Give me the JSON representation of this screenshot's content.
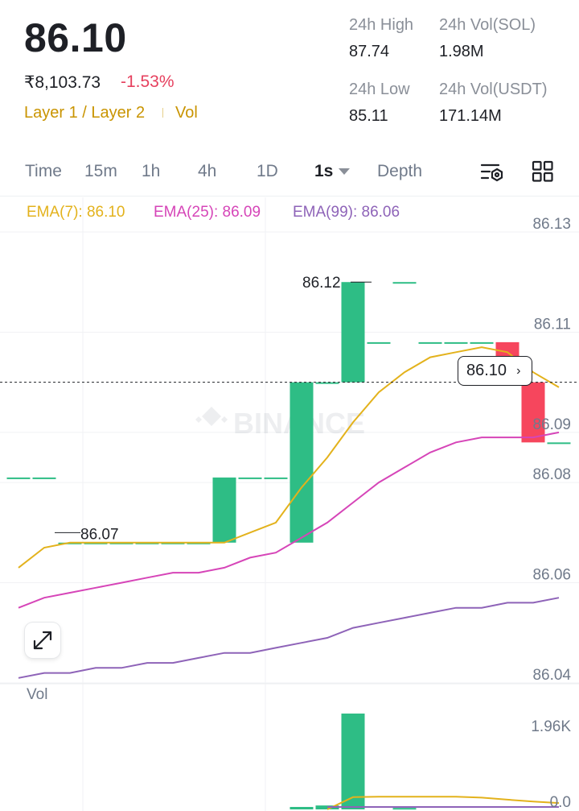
{
  "header": {
    "price": "86.10",
    "price_inr": "₹8,103.73",
    "change": "-1.53%",
    "category": "Layer 1 / Layer 2",
    "category_extra": "Vol",
    "stats": {
      "high_label": "24h High",
      "high_value": "87.74",
      "vol_sol_label": "24h Vol(SOL)",
      "vol_sol_value": "1.98M",
      "low_label": "24h Low",
      "low_value": "85.11",
      "vol_usdt_label": "24h Vol(USDT)",
      "vol_usdt_value": "171.14M"
    }
  },
  "tabs": [
    "Time",
    "15m",
    "1h",
    "4h",
    "1D",
    "1s",
    "Depth"
  ],
  "active_tab": "1s",
  "indicators": {
    "ema7": "EMA(7): 86.10",
    "ema25": "EMA(25): 86.09",
    "ema99": "EMA(99): 86.06"
  },
  "colors": {
    "up": "#2ebd85",
    "down": "#f6465d",
    "ema7": "#e3b21c",
    "ema25": "#d645b8",
    "ema99": "#8e63b8",
    "accent": "#c99400"
  },
  "chart_data": {
    "type": "candlestick",
    "price_ticks": [
      "86.13",
      "86.11",
      "86.09",
      "86.08",
      "86.06",
      "86.04"
    ],
    "current_price_label": "86.10",
    "high_marker": "86.12",
    "low_marker": "86.07",
    "watermark": "BINANCE",
    "candles": [
      {
        "o": 86.081,
        "h": 86.081,
        "l": 86.081,
        "c": 86.081,
        "d": "flat"
      },
      {
        "o": 86.081,
        "h": 86.081,
        "l": 86.081,
        "c": 86.081,
        "d": "flat"
      },
      {
        "o": 86.068,
        "h": 86.068,
        "l": 86.068,
        "c": 86.068,
        "d": "flat"
      },
      {
        "o": 86.068,
        "h": 86.068,
        "l": 86.068,
        "c": 86.068,
        "d": "flat"
      },
      {
        "o": 86.068,
        "h": 86.068,
        "l": 86.068,
        "c": 86.068,
        "d": "flat"
      },
      {
        "o": 86.068,
        "h": 86.068,
        "l": 86.068,
        "c": 86.068,
        "d": "flat"
      },
      {
        "o": 86.068,
        "h": 86.068,
        "l": 86.068,
        "c": 86.068,
        "d": "flat"
      },
      {
        "o": 86.068,
        "h": 86.068,
        "l": 86.068,
        "c": 86.068,
        "d": "flat"
      },
      {
        "o": 86.068,
        "h": 86.081,
        "l": 86.068,
        "c": 86.081,
        "d": "up"
      },
      {
        "o": 86.081,
        "h": 86.081,
        "l": 86.081,
        "c": 86.081,
        "d": "flat"
      },
      {
        "o": 86.081,
        "h": 86.081,
        "l": 86.081,
        "c": 86.081,
        "d": "flat"
      },
      {
        "o": 86.068,
        "h": 86.1,
        "l": 86.068,
        "c": 86.1,
        "d": "up"
      },
      {
        "o": 86.1,
        "h": 86.1,
        "l": 86.1,
        "c": 86.1,
        "d": "flat"
      },
      {
        "o": 86.1,
        "h": 86.12,
        "l": 86.1,
        "c": 86.12,
        "d": "up"
      },
      {
        "o": 86.108,
        "h": 86.108,
        "l": 86.108,
        "c": 86.108,
        "d": "flat"
      },
      {
        "o": 86.12,
        "h": 86.12,
        "l": 86.12,
        "c": 86.12,
        "d": "flat"
      },
      {
        "o": 86.108,
        "h": 86.108,
        "l": 86.108,
        "c": 86.108,
        "d": "flat"
      },
      {
        "o": 86.108,
        "h": 86.108,
        "l": 86.108,
        "c": 86.108,
        "d": "flat"
      },
      {
        "o": 86.108,
        "h": 86.108,
        "l": 86.108,
        "c": 86.108,
        "d": "flat"
      },
      {
        "o": 86.108,
        "h": 86.108,
        "l": 86.1,
        "c": 86.1,
        "d": "down"
      },
      {
        "o": 86.1,
        "h": 86.1,
        "l": 86.088,
        "c": 86.088,
        "d": "down"
      },
      {
        "o": 86.088,
        "h": 86.088,
        "l": 86.088,
        "c": 86.088,
        "d": "flat"
      }
    ],
    "ema7": [
      86.063,
      86.067,
      86.068,
      86.068,
      86.068,
      86.068,
      86.068,
      86.068,
      86.068,
      86.07,
      86.072,
      86.079,
      86.085,
      86.092,
      86.098,
      86.102,
      86.105,
      86.106,
      86.107,
      86.106,
      86.102,
      86.099
    ],
    "ema25": [
      86.055,
      86.057,
      86.058,
      86.059,
      86.06,
      86.061,
      86.062,
      86.062,
      86.063,
      86.065,
      86.066,
      86.069,
      86.072,
      86.076,
      86.08,
      86.083,
      86.086,
      86.088,
      86.089,
      86.089,
      86.089,
      86.09
    ],
    "ema99": [
      86.041,
      86.042,
      86.042,
      86.043,
      86.043,
      86.044,
      86.044,
      86.045,
      86.046,
      86.046,
      86.047,
      86.048,
      86.049,
      86.051,
      86.052,
      86.053,
      86.054,
      86.055,
      86.055,
      86.056,
      86.056,
      86.057
    ],
    "volume": {
      "label": "Vol",
      "ticks": [
        "1.96K",
        "0.0"
      ],
      "values": [
        0,
        0,
        0,
        0,
        0,
        0,
        0,
        0,
        0,
        0,
        0,
        0.05,
        0.08,
        1.96,
        0,
        0.03,
        0,
        0,
        0,
        0,
        0,
        0
      ],
      "ma": [
        0,
        0,
        0,
        0,
        0,
        0,
        0,
        0,
        0,
        0,
        0,
        0,
        0,
        0.25,
        0.26,
        0.26,
        0.26,
        0.26,
        0.24,
        0.2,
        0.16,
        0.13
      ]
    }
  }
}
